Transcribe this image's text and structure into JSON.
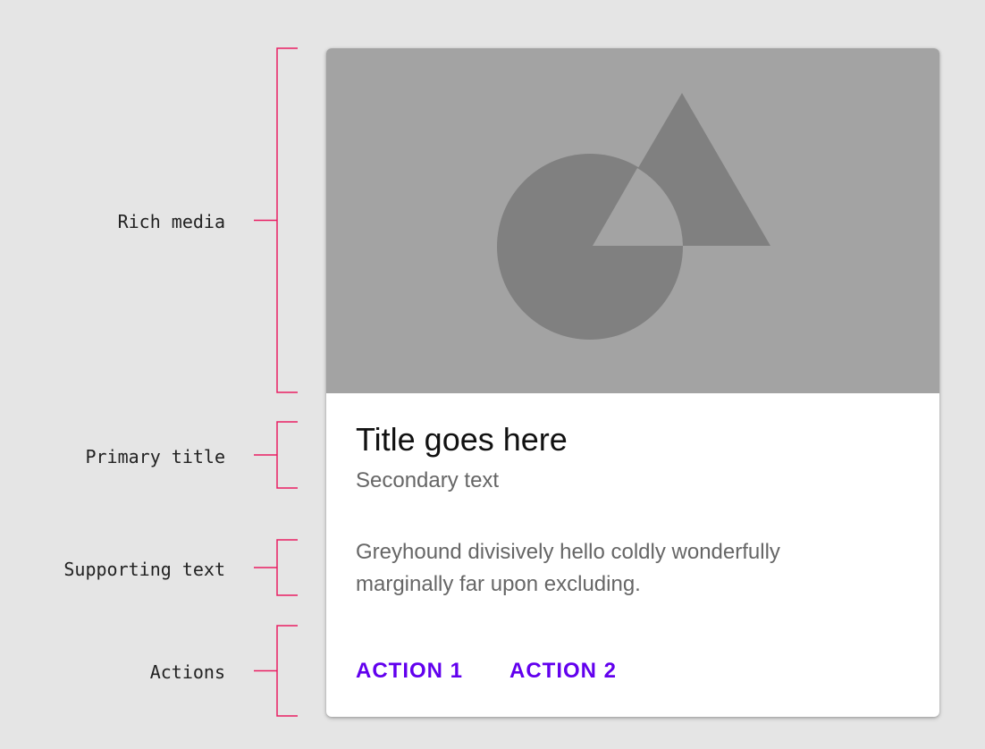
{
  "annotations": {
    "rich_media": "Rich media",
    "primary_title": "Primary title",
    "supporting_text": "Supporting text",
    "actions": "Actions"
  },
  "card": {
    "title": "Title goes here",
    "secondary_text": "Secondary text",
    "supporting_text_line1": "Greyhound divisively hello coldly wonderfully",
    "supporting_text_line2": "marginally far upon excluding.",
    "action_1": "ACTION 1",
    "action_2": "ACTION 2"
  },
  "colors": {
    "background": "#e5e5e5",
    "bracket": "#e91e63",
    "media_background": "#a3a3a3",
    "media_shapes": "#808080",
    "action_text": "#6200ee"
  }
}
